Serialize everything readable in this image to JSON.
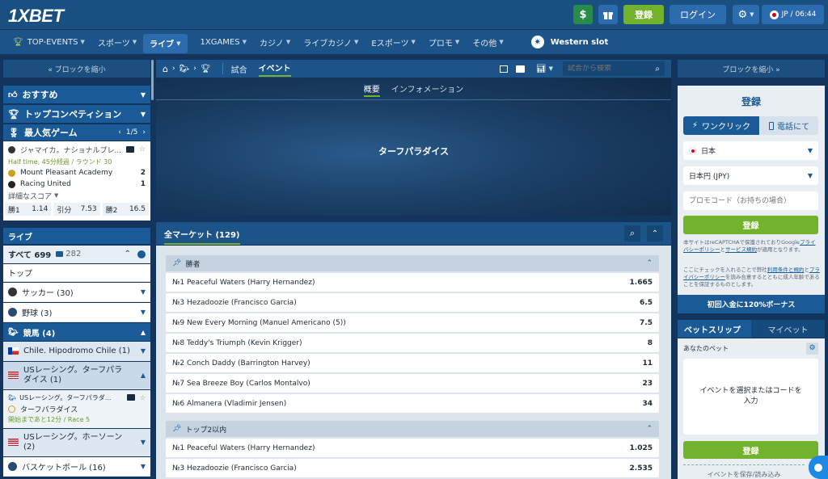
{
  "header": {
    "logo": "1XBET",
    "register": "登録",
    "login": "ログイン",
    "locale": "JP / 06:44"
  },
  "nav": {
    "items": [
      {
        "label": "TOP-EVENTS"
      },
      {
        "label": "スポーツ"
      },
      {
        "label": "ライブ"
      },
      {
        "label": "1XGAMES"
      },
      {
        "label": "カジノ"
      },
      {
        "label": "ライブカジノ"
      },
      {
        "label": "Eスポーツ"
      },
      {
        "label": "プロモ"
      },
      {
        "label": "その他"
      }
    ],
    "western": "Western slot"
  },
  "left": {
    "collapse": "« ブロックを縮小",
    "menu": [
      {
        "label": "おすすめ"
      },
      {
        "label": "トップコンペティション"
      }
    ],
    "popular": {
      "title": "最人気ゲーム",
      "pager": "1/5",
      "league": "ジャマイカ。ナショナルプレ...",
      "status": "Half time, 45分経過 / ラウンド  30",
      "team1": "Mount Pleasant Academy",
      "score1": "2",
      "team2": "Racing United",
      "score2": "1",
      "details": "詳細なスコア",
      "odds": [
        {
          "label": "勝1",
          "value": "1.14"
        },
        {
          "label": "引分",
          "value": "7.53"
        },
        {
          "label": "勝2",
          "value": "16.5"
        }
      ]
    },
    "live": {
      "title": "ライブ",
      "all": "すべて 699",
      "count": "282",
      "top": "トップ",
      "soccer": "サッカー (30)",
      "baseball": "野球 (3)",
      "horse": "競馬 (4)",
      "chile": "Chile. Hipodromo Chile (1)",
      "us_turf": "USレーシング。ターフパラダイス (1)",
      "event_league": "USレーシング。ターフパラダ...",
      "event_name": "ターフパラダイス",
      "event_status": "開始まであと12分 / Race 5",
      "us_hawthorne": "USレーシング。ホーソーン (2)",
      "basketball": "バスケットボール (16)"
    }
  },
  "center": {
    "tabs": [
      "試合",
      "イベント"
    ],
    "search_placeholder": "試合から検索",
    "subtabs": [
      "概要",
      "インフォメーション"
    ],
    "event_title": "ターフパラダイス",
    "markets": "全マーケット (129)",
    "group1": "勝者",
    "winners": [
      {
        "name": "№1 Peaceful Waters (Harry Hernandez)",
        "odd": "1.665"
      },
      {
        "name": "№3 Hezadoozie (Francisco Garcia)",
        "odd": "6.5"
      },
      {
        "name": "№9 New Every Morning (Manuel Americano (5))",
        "odd": "7.5"
      },
      {
        "name": "№8 Teddy's Triumph (Kevin Krigger)",
        "odd": "8"
      },
      {
        "name": "№2 Conch Daddy (Barrington Harvey)",
        "odd": "11"
      },
      {
        "name": "№7 Sea Breeze Boy (Carlos Montalvo)",
        "odd": "23"
      },
      {
        "name": "№6 Almanera (Vladimir Jensen)",
        "odd": "34"
      }
    ],
    "group2": "トップ2以内",
    "top2": [
      {
        "name": "№1 Peaceful Waters (Harry Hernandez)",
        "odd": "1.025"
      },
      {
        "name": "№3 Hezadoozie (Francisco Garcia)",
        "odd": "2.535"
      }
    ]
  },
  "right": {
    "collapse": "ブロックを縮小 »",
    "reg_title": "登録",
    "oneclick": "ワンクリック",
    "byphone": "電話にて",
    "country": "日本",
    "currency": "日本円 (JPY)",
    "promo_placeholder": "プロモコード（お持ちの場合）",
    "register_btn": "登録",
    "recaptcha_a": "本サイトはreCAPTCHAで保護されておりGoogle",
    "recaptcha_link1": "プライバシーポリシー",
    "recaptcha_and": "と",
    "recaptcha_link2": "サービス規約",
    "recaptcha_b": "が適用となります。",
    "terms_a": "ここにチェックを入れることで弊社",
    "terms_link1": "利用条件と規約",
    "terms_and": "と",
    "terms_link2": "プライバシーポリシー",
    "terms_b": "を読み合意するとともに成人年齢であることを保証するものとします。",
    "bonus": "初回入金に120%ボーナス",
    "betslip": "ベットスリップ",
    "mybets": "マイベット",
    "your_bet": "あなたのベット",
    "empty": "イベントを選択またはコードを入力",
    "register_btn2": "登録",
    "save_load": "イベントを保存/読み込み"
  },
  "colors": {
    "accent_green": "#72b22c",
    "brand_blue": "#1a5a96",
    "dark_bg": "#12345d"
  }
}
